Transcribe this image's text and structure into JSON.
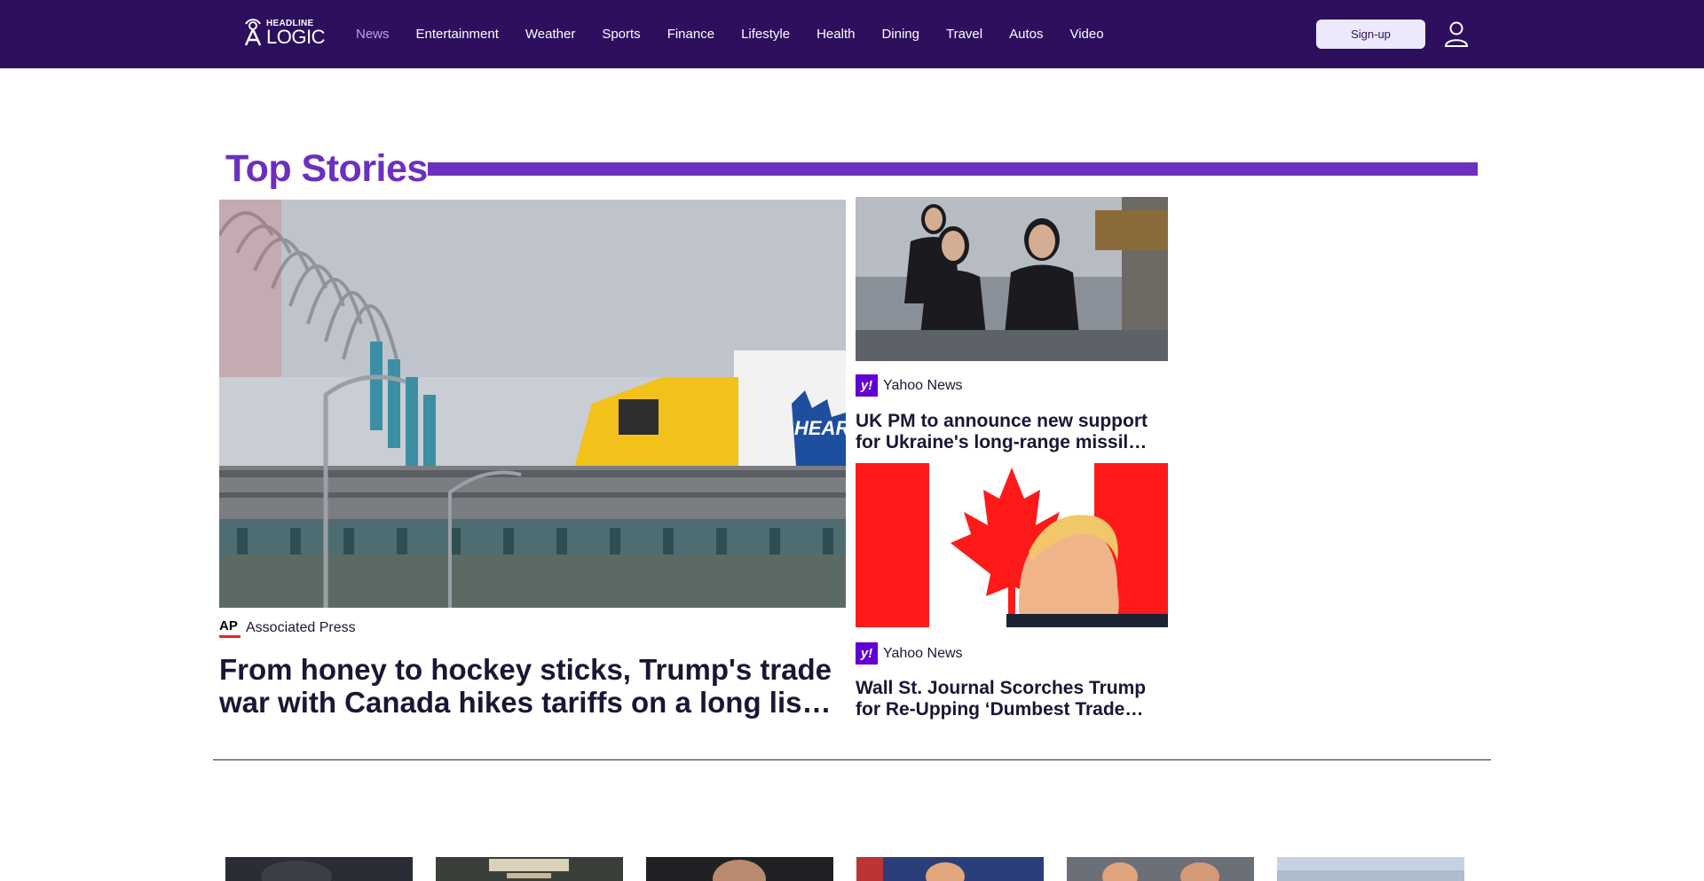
{
  "header": {
    "logo": {
      "top_text": "HEADLINE",
      "bottom_text": "LOGIC"
    },
    "nav": [
      {
        "label": "News",
        "active": true
      },
      {
        "label": "Entertainment"
      },
      {
        "label": "Weather"
      },
      {
        "label": "Sports"
      },
      {
        "label": "Finance"
      },
      {
        "label": "Lifestyle"
      },
      {
        "label": "Health"
      },
      {
        "label": "Dining"
      },
      {
        "label": "Travel"
      },
      {
        "label": "Autos"
      },
      {
        "label": "Video"
      }
    ],
    "signup_label": "Sign-up",
    "user_icon": "user-icon"
  },
  "top_stories": {
    "title": "Top Stories",
    "main": {
      "source": "Associated Press",
      "source_logo": "AP",
      "headline_line1": "From honey to hockey sticks, Trump's trade",
      "headline_line2": "war with Canada hikes tariffs on a long lis…",
      "image_text": "HEART"
    },
    "side": [
      {
        "source": "Yahoo News",
        "source_logo": "y!",
        "headline_line1": "UK PM to announce new support",
        "headline_line2": "for Ukraine's long-range missil…"
      },
      {
        "source": "Yahoo News",
        "source_logo": "y!",
        "headline_line1": "Wall St. Journal Scorches Trump",
        "headline_line2": "for Re-Upping ‘Dumbest Trade…"
      }
    ]
  },
  "colors": {
    "header_bg": "#2d0f5e",
    "accent": "#6c2fc0",
    "nav_active": "#b8a4e6",
    "text": "#1c1535"
  }
}
